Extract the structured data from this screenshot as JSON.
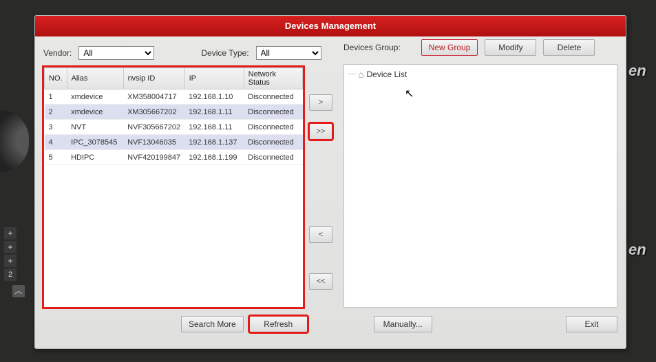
{
  "title": "Devices Management",
  "filters": {
    "vendor_label": "Vendor:",
    "vendor_value": "All",
    "devtype_label": "Device Type:",
    "devtype_value": "All"
  },
  "group_panel": {
    "label": "Devices Group:",
    "new_group": "New Group",
    "modify": "Modify",
    "delete": "Delete",
    "root": "Device List"
  },
  "table": {
    "headers": {
      "no": "NO.",
      "alias": "Alias",
      "nvsip": "nvsip ID",
      "ip": "IP",
      "status": "Network Status"
    },
    "rows": [
      {
        "no": "1",
        "alias": "xmdevice",
        "nvsip": "XM358004717",
        "ip": "192.168.1.10",
        "status": "Disconnected"
      },
      {
        "no": "2",
        "alias": "xmdevice",
        "nvsip": "XM305667202",
        "ip": "192.168.1.11",
        "status": "Disconnected"
      },
      {
        "no": "3",
        "alias": "NVT",
        "nvsip": "NVF305667202",
        "ip": "192.168.1.11",
        "status": "Disconnected"
      },
      {
        "no": "4",
        "alias": "IPC_3078545",
        "nvsip": "NVF13046035",
        "ip": "192.168.1.137",
        "status": "Disconnected"
      },
      {
        "no": "5",
        "alias": "HDIPC",
        "nvsip": "NVF420199847",
        "ip": "192.168.1.199",
        "status": "Disconnected"
      }
    ]
  },
  "arrows": {
    "add": ">",
    "add_all": ">>",
    "remove": "<",
    "remove_all": "<<"
  },
  "footer_buttons": {
    "search_more": "Search More",
    "refresh": "Refresh",
    "manually": "Manually...",
    "exit": "Exit"
  },
  "bg_sidebar": {
    "plus": "+",
    "two": "2",
    "chevrons": "︿"
  }
}
